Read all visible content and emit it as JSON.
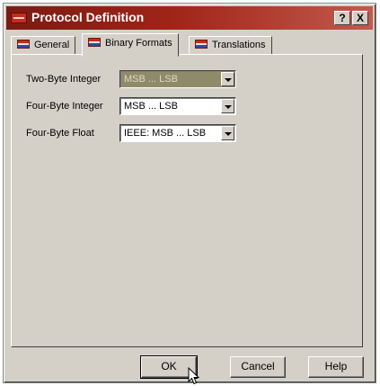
{
  "window": {
    "title": "Protocol Definition",
    "help_glyph": "?",
    "close_glyph": "X"
  },
  "tabs": [
    {
      "label": "General"
    },
    {
      "label": "Binary Formats"
    },
    {
      "label": "Translations"
    }
  ],
  "active_tab": "Binary Formats",
  "fields": [
    {
      "label": "Two-Byte Integer",
      "value": "MSB ... LSB",
      "enabled": false
    },
    {
      "label": "Four-Byte Integer",
      "value": "MSB ... LSB",
      "enabled": true
    },
    {
      "label": "Four-Byte Float",
      "value": "IEEE: MSB ... LSB",
      "enabled": true
    }
  ],
  "buttons": {
    "ok": "OK",
    "cancel": "Cancel",
    "help": "Help"
  },
  "icons": {
    "title": "protocol-icon",
    "tabs": "protocol-tab-icon",
    "dropdown": "chevron-down-icon",
    "pointer": "mouse-cursor-icon"
  }
}
